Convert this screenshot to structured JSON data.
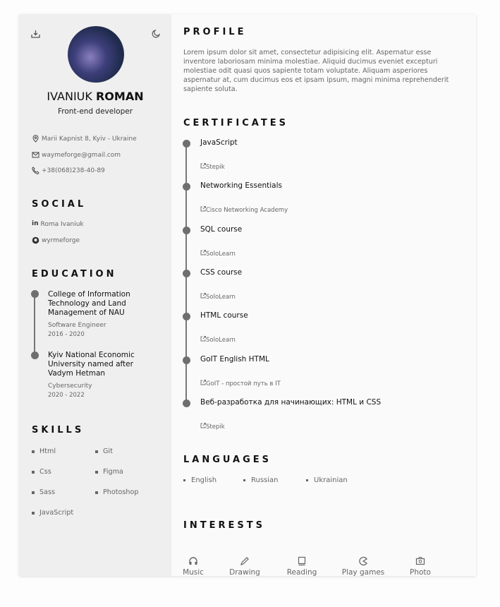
{
  "header": {
    "first_name": "IVANIUK",
    "last_name": "ROMAN",
    "role": "Front-end developer"
  },
  "contacts": {
    "address": "Marii Kapnist 8, Kyiv - Ukraine",
    "email": "waymeforge@gmail.com",
    "phone": "+38(068)238-40-89"
  },
  "social": {
    "title": "SOCIAL",
    "linkedin": "Roma Ivaniuk",
    "github": "wyrmeforge"
  },
  "education": {
    "title": "EDUCATION",
    "items": [
      {
        "school": "College of Information Technology and Land Management of NAU",
        "degree": "Software Engineer",
        "years": "2016 - 2020"
      },
      {
        "school": "Kyiv National Economic University named after Vadym Hetman",
        "degree": "Cybersecurity",
        "years": "2020 - 2022"
      }
    ]
  },
  "skills": {
    "title": "SKILLS",
    "items": [
      "Html",
      "Git",
      "Css",
      "Figma",
      "Sass",
      "Photoshop",
      "JavaScript"
    ]
  },
  "profile": {
    "title": "PROFILE",
    "text": "Lorem ipsum dolor sit amet, consectetur adipisicing elit. Aspernatur esse inventore laboriosam minima molestiae. Aliquid ducimus eveniet excepturi molestiae odit quasi quos sapiente totam voluptate. Aliquam asperiores aspernatur at, cum ducimus eos et ipsam ipsum, magni minima reprehenderit sapiente soluta."
  },
  "certificates": {
    "title": "CERTIFICATES",
    "items": [
      {
        "name": "JavaScript",
        "source": "Stepik"
      },
      {
        "name": "Networking Essentials",
        "source": "Cisco Networking Academy"
      },
      {
        "name": "SQL course",
        "source": "SoloLearn"
      },
      {
        "name": "CSS course",
        "source": "SoloLearn"
      },
      {
        "name": "HTML course",
        "source": "SoloLearn"
      },
      {
        "name": "GoIT English HTML",
        "source": "GoIT - простой путь в IT"
      },
      {
        "name": "Веб-разработка для начинающих: HTML и CSS",
        "source": "Stepik"
      }
    ]
  },
  "languages": {
    "title": "LANGUAGES",
    "items": [
      "English",
      "Russian",
      "Ukrainian"
    ]
  },
  "interests": {
    "title": "INTERESTS",
    "items": [
      {
        "label": "Music",
        "icon": "headphones-icon"
      },
      {
        "label": "Drawing",
        "icon": "pencil-icon"
      },
      {
        "label": "Reading",
        "icon": "book-icon"
      },
      {
        "label": "Play games",
        "icon": "pacman-icon"
      },
      {
        "label": "Photo",
        "icon": "camera-icon"
      }
    ]
  }
}
